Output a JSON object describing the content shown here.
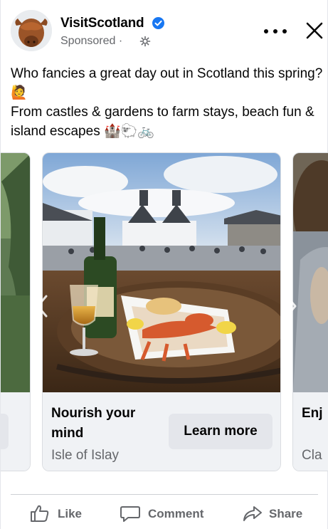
{
  "page": {
    "name": "VisitScotland",
    "sponsored_label": "Sponsored",
    "separator": "·"
  },
  "post": {
    "line1": "Who fancies a great day out in Scotland this spring? 🙋",
    "line2": "From castles & gardens to farm stays, beach fun & island escapes 🏰🐑🚲"
  },
  "carousel": {
    "prev_card": {
      "cta_label": ""
    },
    "main_card": {
      "title": "Nourish your mind",
      "subtitle": "Isle of Islay",
      "cta_label": "Learn more",
      "image_icon": "seafood-whisky-photo"
    },
    "next_card": {
      "title": "Enj",
      "subtitle": "Cla"
    }
  },
  "actions": {
    "like": "Like",
    "comment": "Comment",
    "share": "Share"
  },
  "colors": {
    "verified_blue": "#1877f2",
    "secondary_text": "#65676b",
    "button_bg": "#e4e6eb",
    "card_footer_bg": "#f0f2f5"
  }
}
